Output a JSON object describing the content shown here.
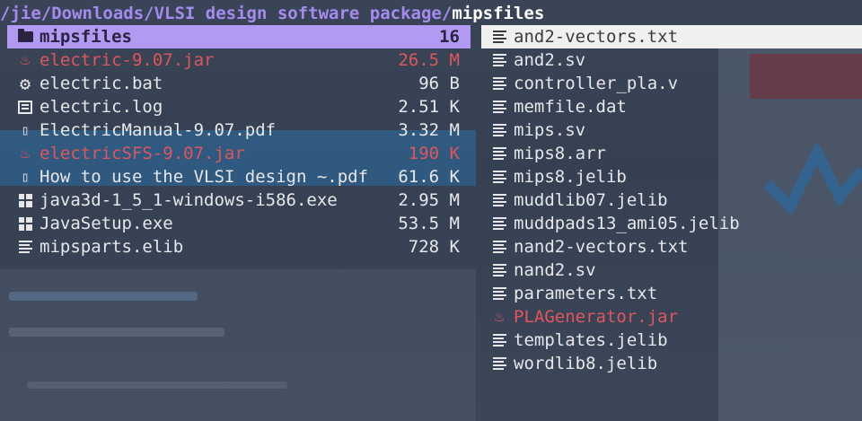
{
  "path": {
    "dir": "/jie/Downloads/VLSI design software package/",
    "current": "mipsfiles"
  },
  "left_pane": [
    {
      "icon": "folder-icon",
      "name": "mipsfiles",
      "size": "16",
      "state": "selected-dir"
    },
    {
      "icon": "java-icon",
      "name": "electric-9.07.jar",
      "size": "26.5 M",
      "state": "red"
    },
    {
      "icon": "gear-icon",
      "name": "electric.bat",
      "size": "96 B",
      "state": "normal"
    },
    {
      "icon": "log-icon",
      "name": "electric.log",
      "size": "2.51 K",
      "state": "normal"
    },
    {
      "icon": "unknown-glyph-icon",
      "name": "ElectricManual-9.07.pdf",
      "size": "3.32 M",
      "state": "normal"
    },
    {
      "icon": "java-icon",
      "name": "electricSFS-9.07.jar",
      "size": "190 K",
      "state": "red"
    },
    {
      "icon": "unknown-glyph-icon",
      "name": "How to use the VLSI design ~.pdf",
      "size": "61.6 K",
      "state": "normal"
    },
    {
      "icon": "windows-icon",
      "name": "java3d-1_5_1-windows-i586.exe",
      "size": "2.95 M",
      "state": "normal"
    },
    {
      "icon": "windows-icon",
      "name": "JavaSetup.exe",
      "size": "53.5 M",
      "state": "normal"
    },
    {
      "icon": "text-file-icon",
      "name": "mipsparts.elib",
      "size": "728 K",
      "state": "normal"
    }
  ],
  "right_pane": [
    {
      "icon": "text-file-icon",
      "name": "and2-vectors.txt",
      "state": "selected-file"
    },
    {
      "icon": "text-file-icon",
      "name": "and2.sv",
      "state": "normal"
    },
    {
      "icon": "text-file-icon",
      "name": "controller_pla.v",
      "state": "normal"
    },
    {
      "icon": "text-file-icon",
      "name": "memfile.dat",
      "state": "normal"
    },
    {
      "icon": "text-file-icon",
      "name": "mips.sv",
      "state": "normal"
    },
    {
      "icon": "text-file-icon",
      "name": "mips8.arr",
      "state": "normal"
    },
    {
      "icon": "text-file-icon",
      "name": "mips8.jelib",
      "state": "normal"
    },
    {
      "icon": "text-file-icon",
      "name": "muddlib07.jelib",
      "state": "normal"
    },
    {
      "icon": "text-file-icon",
      "name": "muddpads13_ami05.jelib",
      "state": "normal"
    },
    {
      "icon": "text-file-icon",
      "name": "nand2-vectors.txt",
      "state": "normal"
    },
    {
      "icon": "text-file-icon",
      "name": "nand2.sv",
      "state": "normal"
    },
    {
      "icon": "text-file-icon",
      "name": "parameters.txt",
      "state": "normal"
    },
    {
      "icon": "java-icon",
      "name": "PLAGenerator.jar",
      "state": "red"
    },
    {
      "icon": "text-file-icon",
      "name": "templates.jelib",
      "state": "normal"
    },
    {
      "icon": "text-file-icon",
      "name": "wordlib8.jelib",
      "state": "normal"
    }
  ],
  "colors": {
    "dir_highlight": "#b29af2",
    "file_highlight": "#f0f0ee",
    "red_text": "#e0555c",
    "path_dir": "#a58bf0"
  }
}
